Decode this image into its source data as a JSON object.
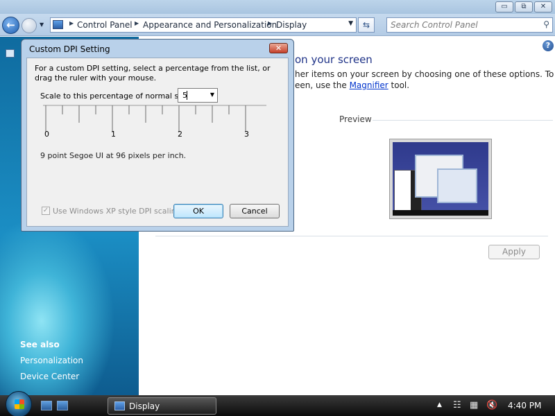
{
  "window": {
    "breadcrumbs": [
      "Control Panel",
      "Appearance and Personalization",
      "Display"
    ],
    "search_placeholder": "Search Control Panel",
    "caption_buttons": {
      "minimize": "▭",
      "maximize": "⧉",
      "close": "✕"
    }
  },
  "sidebar": {
    "see_also": "See also",
    "links": [
      "Personalization",
      "Device Center"
    ]
  },
  "content": {
    "title_fragment": "on your screen",
    "desc_line1": "her items on your screen by choosing one of these options. To",
    "desc_line2_pre": "een, use the ",
    "desc_link": "Magnifier",
    "desc_line2_post": " tool.",
    "preview_label": "Preview",
    "apply_label": "Apply"
  },
  "dialog": {
    "title": "Custom DPI Setting",
    "instruction_line1": "For a custom DPI setting, select a percentage from the list, or",
    "instruction_line2": "drag the ruler with your mouse.",
    "scale_label": "Scale to this percentage of normal size:",
    "scale_value": "5",
    "ruler_labels": [
      "0",
      "1",
      "2",
      "3"
    ],
    "dpi_note": "9 point Segoe UI at 96 pixels per inch.",
    "xp_checkbox_label": "Use Windows XP style DPI scaling",
    "xp_checkbox_checked": true,
    "ok_label": "OK",
    "cancel_label": "Cancel"
  },
  "taskbar": {
    "active_window": "Display",
    "clock": "4:40 PM"
  }
}
